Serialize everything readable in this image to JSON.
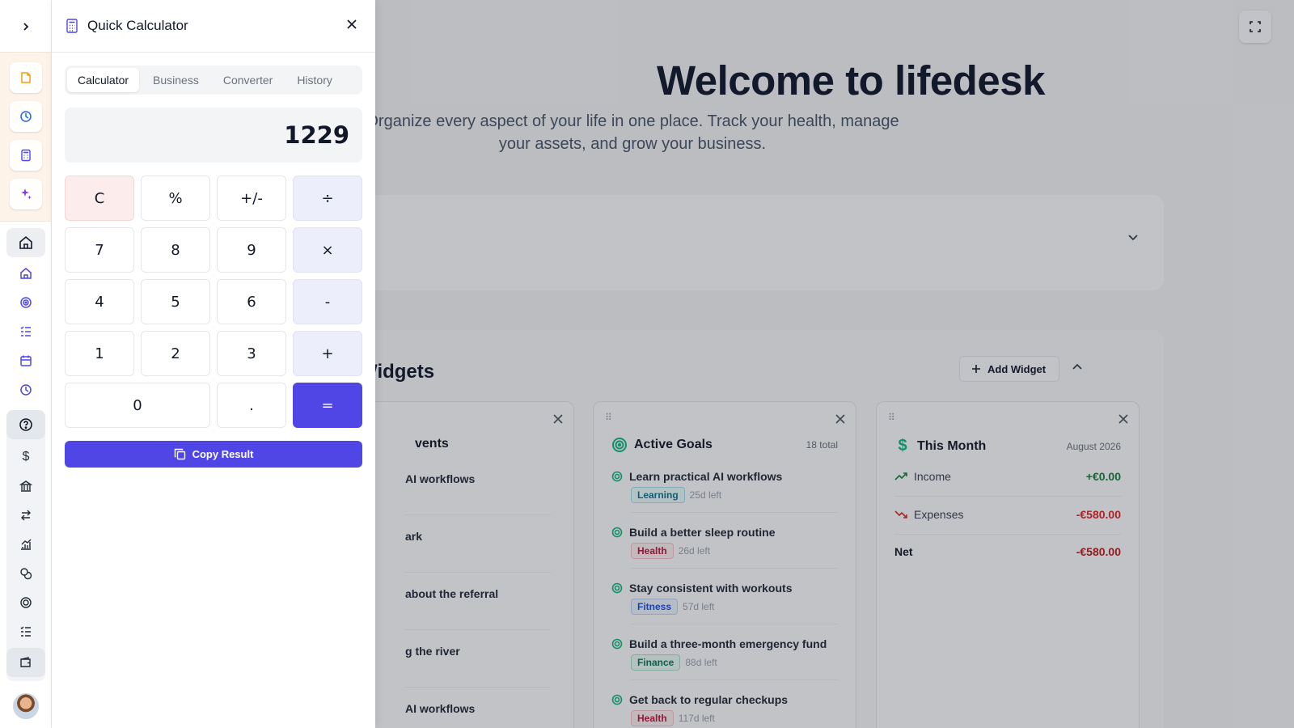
{
  "hero": {
    "title": "Welcome to lifedesk",
    "subtitle": "Organize every aspect of your life in one place. Track your health, manage your assets, and grow your business."
  },
  "widgets": {
    "title": "Widgets",
    "add_label": "Add Widget",
    "events": {
      "title": "vents",
      "rows": [
        "AI workflows",
        "ark",
        "about the referral",
        "g the river",
        "AI workflows"
      ]
    },
    "goals": {
      "title": "Active Goals",
      "count": "18 total",
      "items": [
        {
          "title": "Learn practical AI workflows",
          "tag": "Learning",
          "left": "25d left"
        },
        {
          "title": "Build a better sleep routine",
          "tag": "Health",
          "left": "26d left"
        },
        {
          "title": "Stay consistent with workouts",
          "tag": "Fitness",
          "left": "57d left"
        },
        {
          "title": "Build a three-month emergency fund",
          "tag": "Finance",
          "left": "88d left"
        },
        {
          "title": "Get back to regular checkups",
          "tag": "Health",
          "left": "117d left"
        }
      ]
    },
    "month": {
      "title": "This Month",
      "period": "August 2026",
      "income_label": "Income",
      "income_value": "+€0.00",
      "expenses_label": "Expenses",
      "expenses_value": "-€580.00",
      "net_label": "Net",
      "net_value": "-€580.00"
    }
  },
  "calculator": {
    "title": "Quick Calculator",
    "tabs": [
      "Calculator",
      "Business",
      "Converter",
      "History"
    ],
    "active_tab": "Calculator",
    "display": "1229",
    "keys": {
      "clear": "C",
      "percent": "%",
      "sign": "+/-",
      "divide": "÷",
      "k7": "7",
      "k8": "8",
      "k9": "9",
      "multiply": "×",
      "k4": "4",
      "k5": "5",
      "k6": "6",
      "minus": "-",
      "k1": "1",
      "k2": "2",
      "k3": "3",
      "plus": "+",
      "k0": "0",
      "dot": ".",
      "equals": "="
    },
    "copy_label": "Copy Result"
  },
  "colors": {
    "accent": "#4f46e5",
    "positive": "#15803d",
    "negative": "#dc2626",
    "goal_icon": "#10b981"
  },
  "icons": {
    "rail_quick": [
      "note-icon",
      "clock-icon",
      "calculator-icon",
      "sparkles-icon"
    ],
    "rail_nav": [
      "home-icon",
      "house-icon",
      "target-icon",
      "list-icon",
      "calendar-icon",
      "clock-icon",
      "help-icon",
      "dollar-icon",
      "bank-icon",
      "transfer-icon",
      "chart-icon",
      "coins-icon",
      "target-icon",
      "list-icon",
      "wallet-icon"
    ]
  }
}
